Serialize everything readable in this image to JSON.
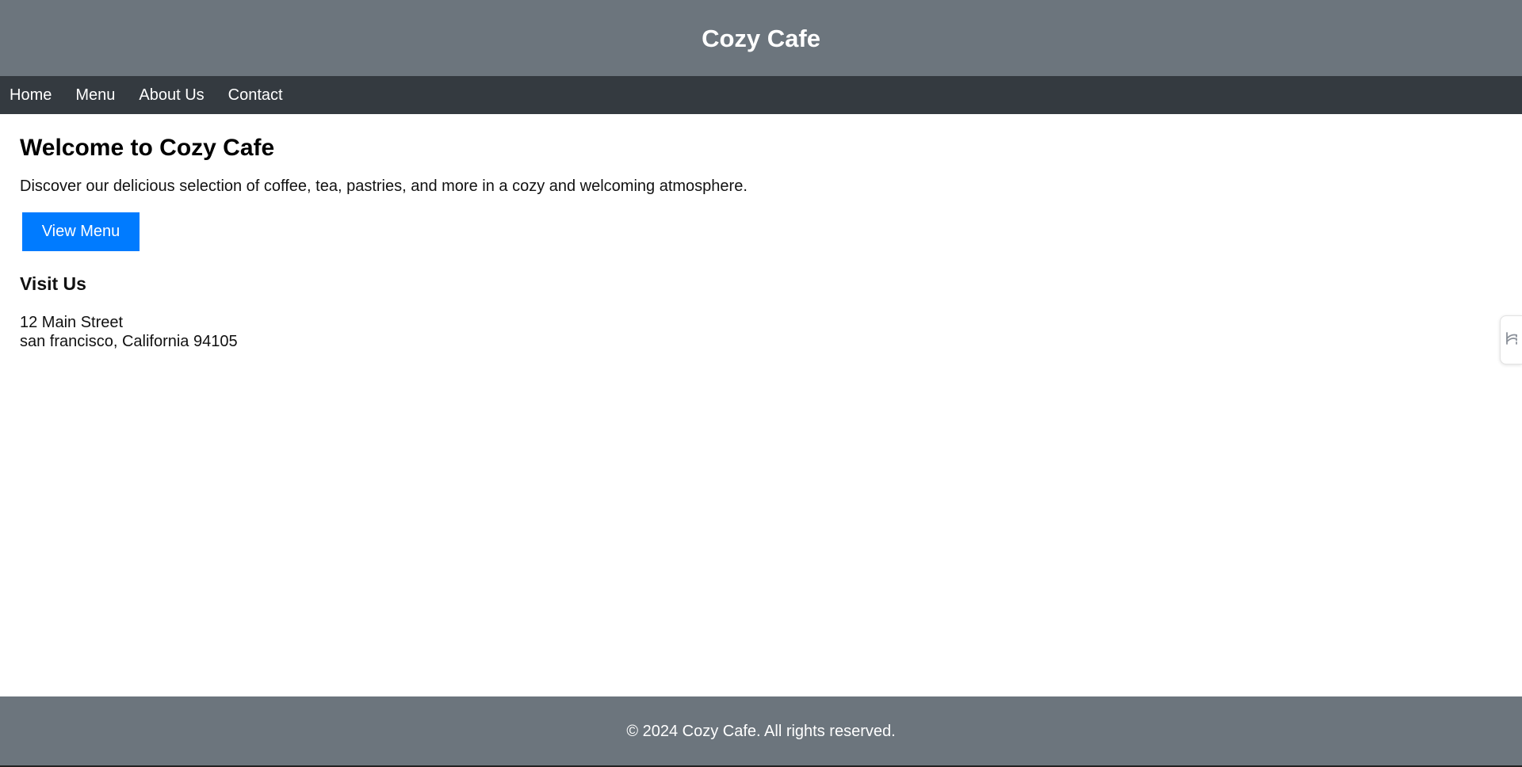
{
  "header": {
    "title": "Cozy Cafe"
  },
  "nav": {
    "items": [
      {
        "label": "Home"
      },
      {
        "label": "Menu"
      },
      {
        "label": "About Us"
      },
      {
        "label": "Contact"
      }
    ]
  },
  "main": {
    "heading": "Welcome to Cozy Cafe",
    "intro": "Discover our delicious selection of coffee, tea, pastries, and more in a cozy and welcoming atmosphere.",
    "button_label": "View Menu",
    "visit": {
      "heading": "Visit Us",
      "address_line1": "12 Main Street",
      "address_line2": "san francisco, California 94105"
    }
  },
  "footer": {
    "text": "© 2024 Cozy Cafe. All rights reserved."
  },
  "side_widget": {
    "icon": "translate-icon"
  },
  "colors": {
    "header_bg": "#6c757d",
    "nav_bg": "#343a40",
    "button_bg": "#007bff",
    "footer_bg": "#6c757d"
  }
}
